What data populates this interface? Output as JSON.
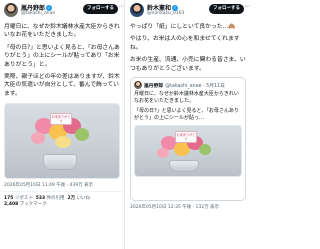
{
  "left": {
    "user": {
      "name": "嵐丹野郎",
      "handle": "@takashi_anae",
      "follow_label": "フォローする"
    },
    "paragraphs": [
      "月曜日に、なぜか鈴木議林水産大臣からきれいなお花をいただきました。",
      "「母の日?」と思いよく見ると、「お母さんありがとう」の上にシールが貼ってあり「お米ありがとう」と。",
      "実際、親子ほどの年の差はありますが、鈴木大臣の気遣いが自分として、番んで飾っています。"
    ],
    "plaque_text": "お米ありがとう",
    "meta": "2026年05月10日 11:49 午後 · 439万 表示",
    "stats": {
      "replies_count": "175",
      "replies_label": "リポスト",
      "quotes_count": "533",
      "quotes_label": "件の引用",
      "likes_count": "2万",
      "likes_label": "いいね",
      "bookmarks_count": "2,408",
      "bookmarks_label": "ブックマーク"
    }
  },
  "right": {
    "user": {
      "name": "鈴木憲和",
      "handle": "@norikazu_0103",
      "follow_label": "フォローする"
    },
    "paragraphs": [
      "やっぱり「紙」にしといて良かった…🙈",
      "やはり、お米は人の心を和ませてくれますね。",
      "お米の生産、流通、小売に関わる皆さま、いつもありがとうございます。"
    ],
    "quote": {
      "name": "嵐丹野郎",
      "handle": "@takashi_anae · 5月11日",
      "paragraphs": [
        "月曜日に、なぜか鈴木議林水産大臣からきれいなお花をいただきました。",
        "「母の日?」と思いよく見ると、「お母さんありがとう」の上にシールが貼っ…"
      ],
      "plaque_text": "お米ありがとう"
    },
    "meta": "2026年05月10日 12:35 午後 · 132万 表示"
  }
}
